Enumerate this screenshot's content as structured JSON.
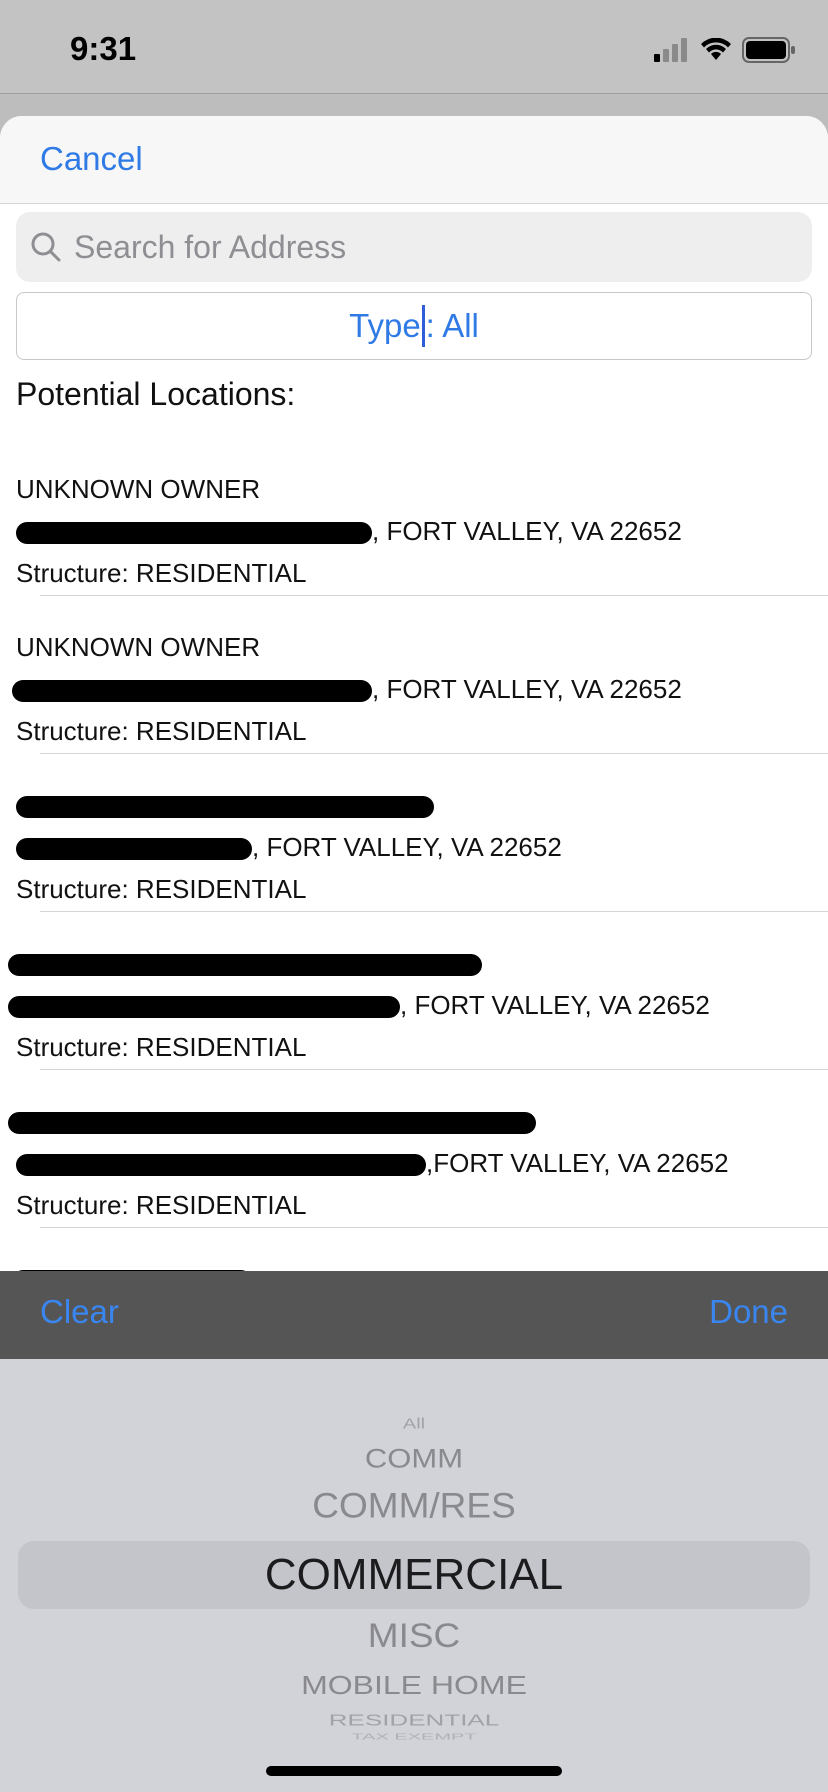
{
  "status": {
    "time": "9:31"
  },
  "nav": {
    "cancel_label": "Cancel"
  },
  "search": {
    "placeholder": "Search for Address"
  },
  "type_filter": {
    "prefix": "Type",
    "suffix": ": All"
  },
  "section_title": "Potential Locations:",
  "locations": [
    {
      "owner": "UNKNOWN OWNER",
      "address": ", FORT VALLEY, VA 22652",
      "structure": "Structure: RESIDENTIAL"
    },
    {
      "owner": "UNKNOWN OWNER",
      "address": ", FORT VALLEY, VA 22652",
      "structure": "Structure: RESIDENTIAL"
    },
    {
      "owner": "",
      "address": ", FORT VALLEY, VA 22652",
      "structure": "Structure: RESIDENTIAL"
    },
    {
      "owner": "",
      "address": ", FORT VALLEY, VA 22652",
      "structure": "Structure: RESIDENTIAL"
    },
    {
      "owner": "",
      "address": ",FORT VALLEY, VA 22652",
      "structure": "Structure: RESIDENTIAL"
    }
  ],
  "picker_toolbar": {
    "clear_label": "Clear",
    "done_label": "Done"
  },
  "picker": {
    "options": [
      "All",
      "COMM",
      "COMM/RES",
      "COMMERCIAL",
      "MISC",
      "MOBILE HOME",
      "RESIDENTIAL",
      "TAX EXEMPT"
    ],
    "selected": "COMMERCIAL"
  },
  "colors": {
    "accent": "#2f7ae5",
    "toolbar": "#555555",
    "picker_bg": "#d1d3d8"
  }
}
